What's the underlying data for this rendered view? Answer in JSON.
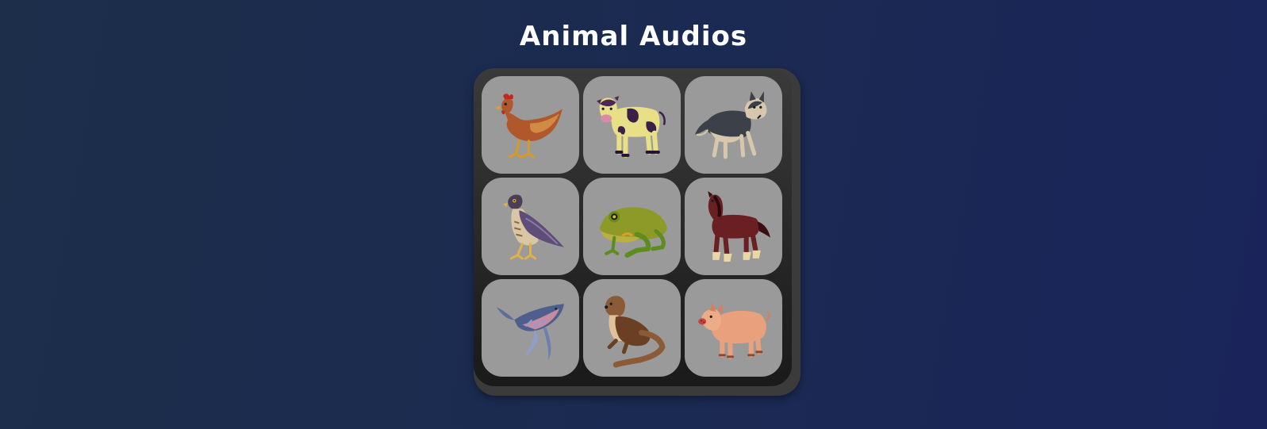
{
  "page": {
    "title": "Animal Audios"
  },
  "tiles": [
    {
      "animal": "chicken",
      "icon": "chicken-icon"
    },
    {
      "animal": "cow",
      "icon": "cow-icon"
    },
    {
      "animal": "wolf",
      "icon": "wolf-icon"
    },
    {
      "animal": "hawk",
      "icon": "hawk-icon"
    },
    {
      "animal": "frog",
      "icon": "frog-icon"
    },
    {
      "animal": "horse",
      "icon": "horse-icon"
    },
    {
      "animal": "whale",
      "icon": "whale-icon"
    },
    {
      "animal": "otter",
      "icon": "otter-icon"
    },
    {
      "animal": "pig",
      "icon": "pig-icon"
    }
  ],
  "colors": {
    "background_left": "#1c2e4a",
    "background_right": "#1a245a",
    "board": "#2a2a2a",
    "tile": "#9a9a9a",
    "title": "#ffffff"
  }
}
